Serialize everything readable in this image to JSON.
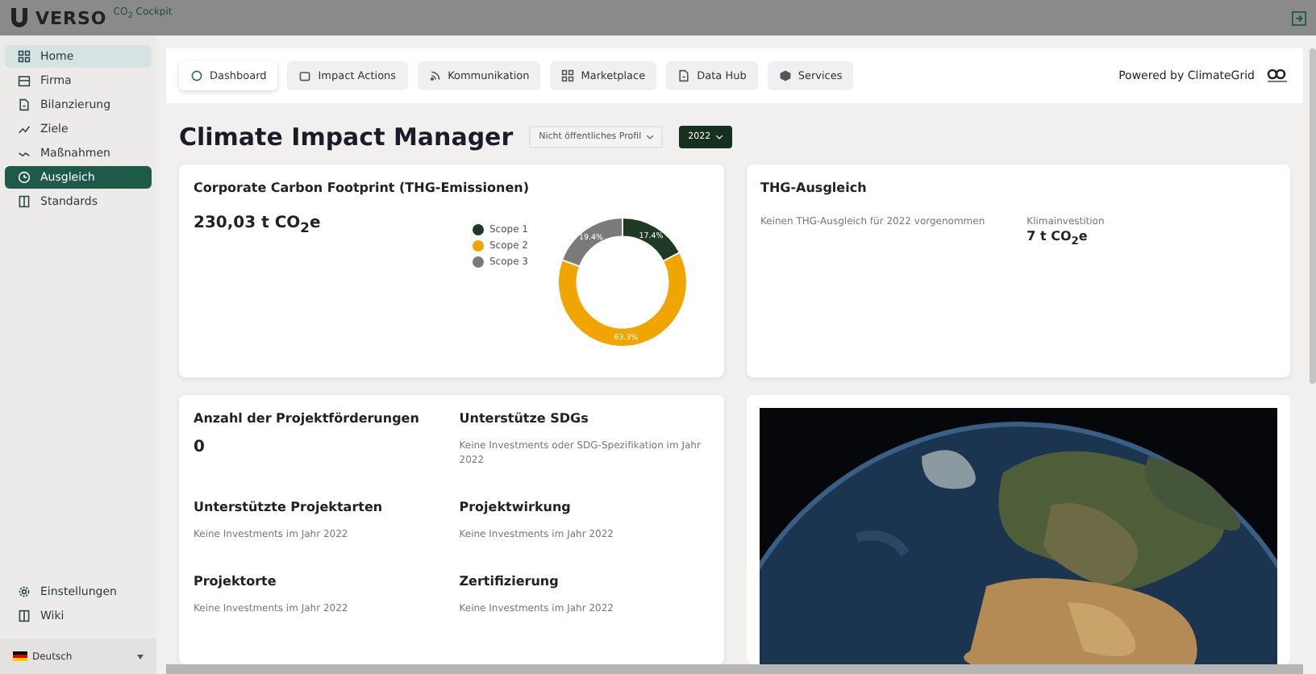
{
  "app": {
    "brand": "VERSO",
    "product": "CO$_{2}$ Cockpit"
  },
  "sidebar": {
    "items": [
      {
        "label": "Home",
        "selected": false,
        "highlighted": true
      },
      {
        "label": "Firma",
        "selected": false,
        "highlighted": false
      },
      {
        "label": "Bilanzierung",
        "selected": false,
        "highlighted": false
      },
      {
        "label": "Ziele",
        "selected": false,
        "highlighted": false
      },
      {
        "label": "Maßnahmen",
        "selected": false,
        "highlighted": false
      },
      {
        "label": "Ausgleich",
        "selected": true,
        "highlighted": false
      },
      {
        "label": "Standards",
        "selected": false,
        "highlighted": false
      }
    ],
    "bottom_items": [
      {
        "label": "Einstellungen"
      },
      {
        "label": "Wiki"
      }
    ],
    "language": "Deutsch"
  },
  "nav": {
    "tabs": [
      {
        "label": "Dashboard",
        "selected": true
      },
      {
        "label": "Impact Actions",
        "selected": false
      },
      {
        "label": "Kommunikation",
        "selected": false
      },
      {
        "label": "Marketplace",
        "selected": false
      },
      {
        "label": "Data Hub",
        "selected": false
      },
      {
        "label": "Services",
        "selected": false
      }
    ],
    "powered_by": "Powered by ClimateGrid"
  },
  "page": {
    "title": "Climate Impact Manager",
    "profile_select": "Nicht öffentliches Profil",
    "year_select": "2022"
  },
  "footprint": {
    "title": "Corporate Carbon Footprint (THG-Emissionen)",
    "total": "230,03 t CO$_{2}$e",
    "chart_data": {
      "type": "donut",
      "categories": [
        "Scope 1",
        "Scope 2",
        "Scope 3"
      ],
      "values": [
        17.4,
        63.3,
        19.4
      ],
      "value_labels": [
        "17.4%",
        "63.3%",
        "19.4%"
      ]
    }
  },
  "compensation": {
    "title": "THG-Ausgleich",
    "note": "Keinen THG-Ausgleich für 2022 vorgenommen",
    "metric_label": "Klimainvestition",
    "metric_value": "7 t CO$_{2}$e"
  },
  "projects": {
    "sections": [
      {
        "title": "Anzahl der Projektförderungen",
        "kind": "value",
        "text": "0"
      },
      {
        "title": "Unterstütze SDGs",
        "kind": "note",
        "text": "Keine Investments oder SDG-Spezifikation im Jahr 2022"
      },
      {
        "title": "Unterstützte Projektarten",
        "kind": "note",
        "text": "Keine Investments im Jahr 2022"
      },
      {
        "title": "Projektwirkung",
        "kind": "note",
        "text": "Keine Investments im Jahr 2022"
      },
      {
        "title": "Projektorte",
        "kind": "note",
        "text": "Keine Investments im Jahr 2022"
      },
      {
        "title": "Zertifizierung",
        "kind": "note",
        "text": "Keine Investments im Jahr 2022"
      }
    ]
  }
}
